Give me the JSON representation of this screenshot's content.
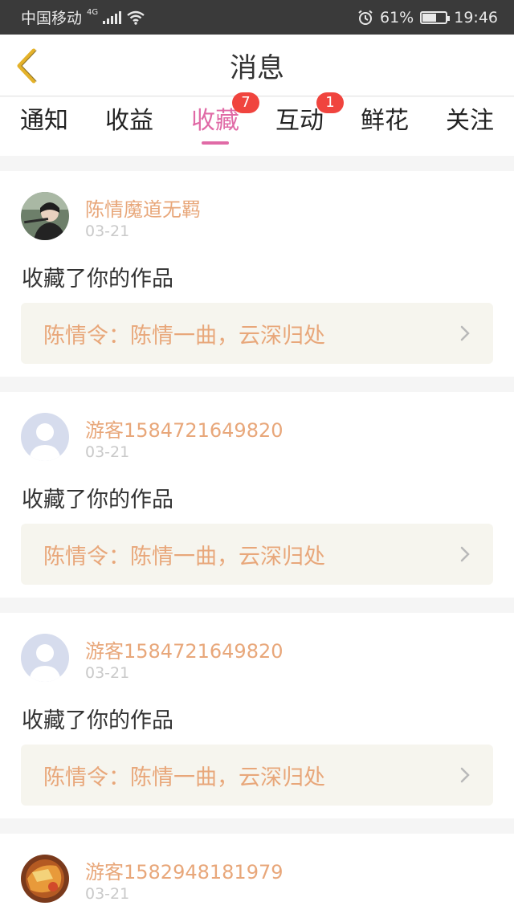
{
  "status_bar": {
    "carrier": "中国移动",
    "network": "4G",
    "battery_percent": "61%",
    "battery_level": 0.61,
    "time": "19:46"
  },
  "header": {
    "title": "消息"
  },
  "tabs": [
    {
      "label": "通知",
      "badge": ""
    },
    {
      "label": "收益",
      "badge": ""
    },
    {
      "label": "收藏",
      "badge": "7",
      "active": true
    },
    {
      "label": "互动",
      "badge": "1"
    },
    {
      "label": "鲜花",
      "badge": ""
    },
    {
      "label": "关注",
      "badge": ""
    }
  ],
  "messages": [
    {
      "user": "陈情魔道无羁",
      "date": "03-21",
      "action": "收藏了你的作品",
      "work": "陈情令：陈情一曲，云深归处",
      "avatar": "photo-avatar"
    },
    {
      "user": "游客1584721649820",
      "date": "03-21",
      "action": "收藏了你的作品",
      "work": "陈情令：陈情一曲，云深归处",
      "avatar": "default-avatar"
    },
    {
      "user": "游客1584721649820",
      "date": "03-21",
      "action": "收藏了你的作品",
      "work": "陈情令：陈情一曲，云深归处",
      "avatar": "default-avatar"
    },
    {
      "user": "游客1582948181979",
      "date": "03-21",
      "action": "",
      "work": "",
      "avatar": "food-avatar"
    }
  ],
  "colors": {
    "accent": "#e06aa6",
    "username": "#e8a77a",
    "badge": "#f0443e",
    "back_icon": "#e4b22a"
  }
}
